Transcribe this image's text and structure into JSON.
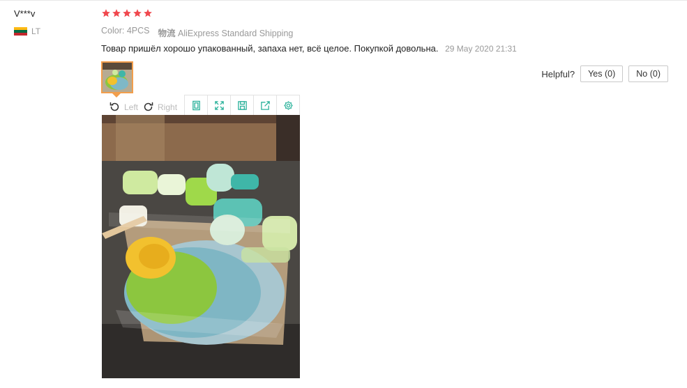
{
  "reviewer": {
    "name": "V***v",
    "country_code": "LT",
    "flag_colors": [
      "#fdb913",
      "#006a44",
      "#c1272d"
    ]
  },
  "rating": {
    "stars": 5,
    "max": 5,
    "color": "#f0484e"
  },
  "order_info": {
    "color_label": "Color: 4PCS",
    "shipping_cn": "物流",
    "shipping": "AliExpress Standard Shipping"
  },
  "review": {
    "text": "Товар пришёл хорошо упакованный, запаха нет, всё целое. Покупкой довольна.",
    "date": "29 May 2020 21:31"
  },
  "helpful": {
    "label": "Helpful?",
    "yes": "Yes (0)",
    "no": "No (0)"
  },
  "viewer": {
    "rotate_left": "Left",
    "rotate_right": "Right",
    "tools": [
      "original-size-icon",
      "fullscreen-icon",
      "save-icon",
      "share-icon",
      "settings-icon"
    ],
    "accent": "#2bb29b"
  },
  "colors": {
    "thumb_border": "#f29e4c",
    "muted_text": "#999999"
  }
}
